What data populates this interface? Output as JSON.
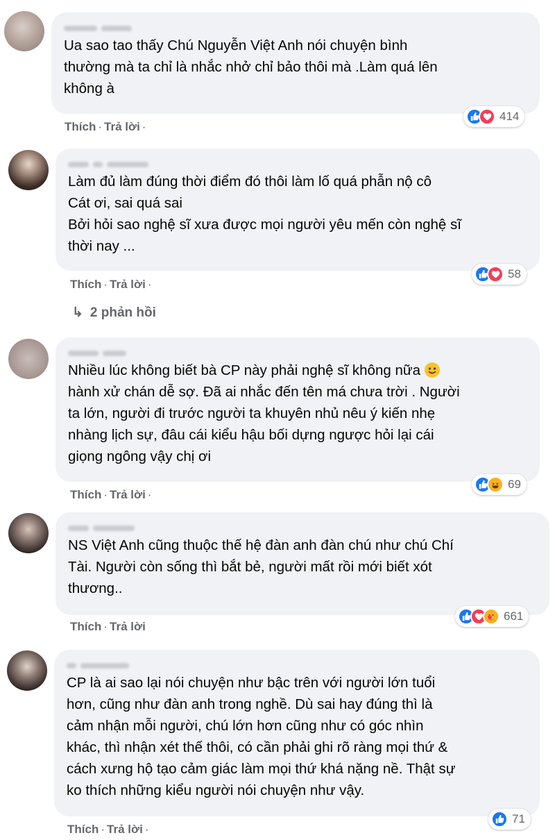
{
  "comments": [
    {
      "text": "Ua sao tao thấy Chú Nguyễn Việt Anh nói chuyện bình\nthường mà ta chỉ là nhắc nhở chỉ bảo thôi mà .Làm quá lên\nkhông à",
      "like_label": "Thích",
      "reply_label": "Trả lời",
      "reactions": [
        "like-icon",
        "love-icon"
      ],
      "count": "414"
    },
    {
      "text": "Làm đủ làm đúng thời điểm đó thôi làm lố quá phẫn nộ cô\nCát ơi, sai quá sai\nBởi hỏi sao nghệ sĩ xưa được mọi người yêu mến còn nghệ sĩ\nthời nay ...",
      "like_label": "Thích",
      "reply_label": "Trả lời",
      "reactions": [
        "like-icon",
        "love-icon"
      ],
      "count": "58",
      "replies_label": "2 phản hồi"
    },
    {
      "text_before_emoji": "Nhiều lúc không biết bà CP này phải nghệ sĩ không nữa ",
      "emoji": "slightly-smiling-face-icon",
      "text": "hành xử chán dễ sợ. Đã ai nhắc đến tên má chưa trời . Người\nta lớn, người đi trước người ta khuyên nhủ nêu ý kiến nhẹ\nnhàng lịch sự, đâu cái kiểu hậu bối dựng ngược hỏi lại cái\ngiọng ngông vậy chị ơi",
      "like_label": "Thích",
      "reply_label": "Trả lời",
      "reactions": [
        "like-icon",
        "haha-icon"
      ],
      "count": "69"
    },
    {
      "text": "NS Việt Anh cũng thuộc thế hệ đàn anh đàn chú như chú Chí\nTài. Người còn sống thì bắt bẻ, người mất rồi mới biết xót\nthương..",
      "like_label": "Thích",
      "reply_label": "Trả lời",
      "reactions": [
        "like-icon",
        "love-icon",
        "care-icon"
      ],
      "count": "661"
    },
    {
      "text": "CP là ai sao lại nói chuyện như bậc trên với người lớn tuổi\nhơn, cũng như đàn anh trong nghề. Dù sai hay đúng thì là\ncảm nhận mỗi người, chú lớn hơn cũng như có góc nhìn\nkhác, thì nhận xét thế thôi, có cần phải ghi rõ ràng mọi thứ &\ncách xưng hộ tạo cảm giác làm mọi thứ khá nặng nề. Thật sự\nko thích những kiểu người nói chuyện như vậy.",
      "like_label": "Thích",
      "reply_label": "Trả lời",
      "reactions": [
        "like-icon"
      ],
      "count": "71"
    }
  ],
  "colors": {
    "bubble": "#f0f2f5",
    "meta": "#65676b",
    "like": "#1877f2",
    "love": "#f33e58",
    "haha": "#f7b125"
  }
}
